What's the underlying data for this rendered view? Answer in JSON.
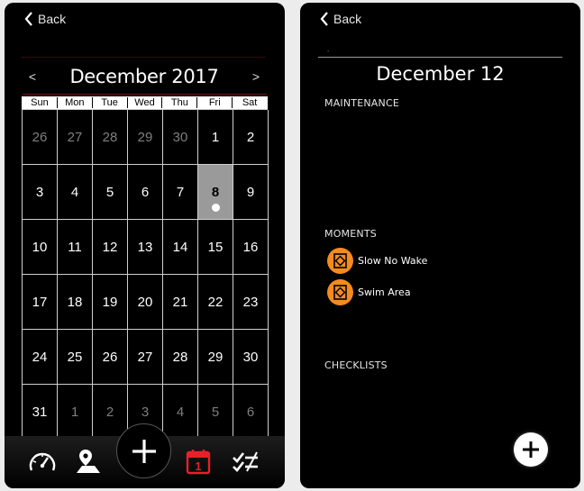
{
  "left": {
    "back_label": "Back",
    "prev_label": "<",
    "next_label": ">",
    "month_title": "December 2017",
    "weekdays": [
      "Sun",
      "Mon",
      "Tue",
      "Wed",
      "Thu",
      "Fri",
      "Sat"
    ],
    "weeks": [
      [
        {
          "d": "26",
          "o": true
        },
        {
          "d": "27",
          "o": true
        },
        {
          "d": "28",
          "o": true
        },
        {
          "d": "29",
          "o": true
        },
        {
          "d": "30",
          "o": true
        },
        {
          "d": "1"
        },
        {
          "d": "2"
        }
      ],
      [
        {
          "d": "3"
        },
        {
          "d": "4"
        },
        {
          "d": "5"
        },
        {
          "d": "6"
        },
        {
          "d": "7"
        },
        {
          "d": "8",
          "sel": true
        },
        {
          "d": "9"
        }
      ],
      [
        {
          "d": "10"
        },
        {
          "d": "11"
        },
        {
          "d": "12"
        },
        {
          "d": "13"
        },
        {
          "d": "14"
        },
        {
          "d": "15"
        },
        {
          "d": "16"
        }
      ],
      [
        {
          "d": "17"
        },
        {
          "d": "18"
        },
        {
          "d": "19"
        },
        {
          "d": "20"
        },
        {
          "d": "21"
        },
        {
          "d": "22"
        },
        {
          "d": "23"
        }
      ],
      [
        {
          "d": "24"
        },
        {
          "d": "25"
        },
        {
          "d": "26"
        },
        {
          "d": "27"
        },
        {
          "d": "28"
        },
        {
          "d": "29"
        },
        {
          "d": "30"
        }
      ],
      [
        {
          "d": "31"
        },
        {
          "d": "1",
          "o": true
        },
        {
          "d": "2",
          "o": true
        },
        {
          "d": "3",
          "o": true
        },
        {
          "d": "4",
          "o": true
        },
        {
          "d": "5",
          "o": true
        },
        {
          "d": "6",
          "o": true
        }
      ]
    ],
    "tabs": {
      "calendar_number": "1",
      "icons": [
        "speedometer-icon",
        "map-pin-icon",
        "plus-icon",
        "calendar-icon",
        "checklist-icon"
      ]
    },
    "colors": {
      "active_tab": "#e8202a",
      "selected_day": "#9a9a9a"
    }
  },
  "right": {
    "back_label": "Back",
    "dots": ".",
    "day_title": "December 12",
    "maintenance_label": "MAINTENANCE",
    "moments_label": "MOMENTS",
    "moments": [
      {
        "label": "Slow No Wake"
      },
      {
        "label": "Swim Area"
      }
    ],
    "checklists_label": "CHECKLISTS",
    "colors": {
      "moment_icon": "#f58a1f"
    }
  }
}
